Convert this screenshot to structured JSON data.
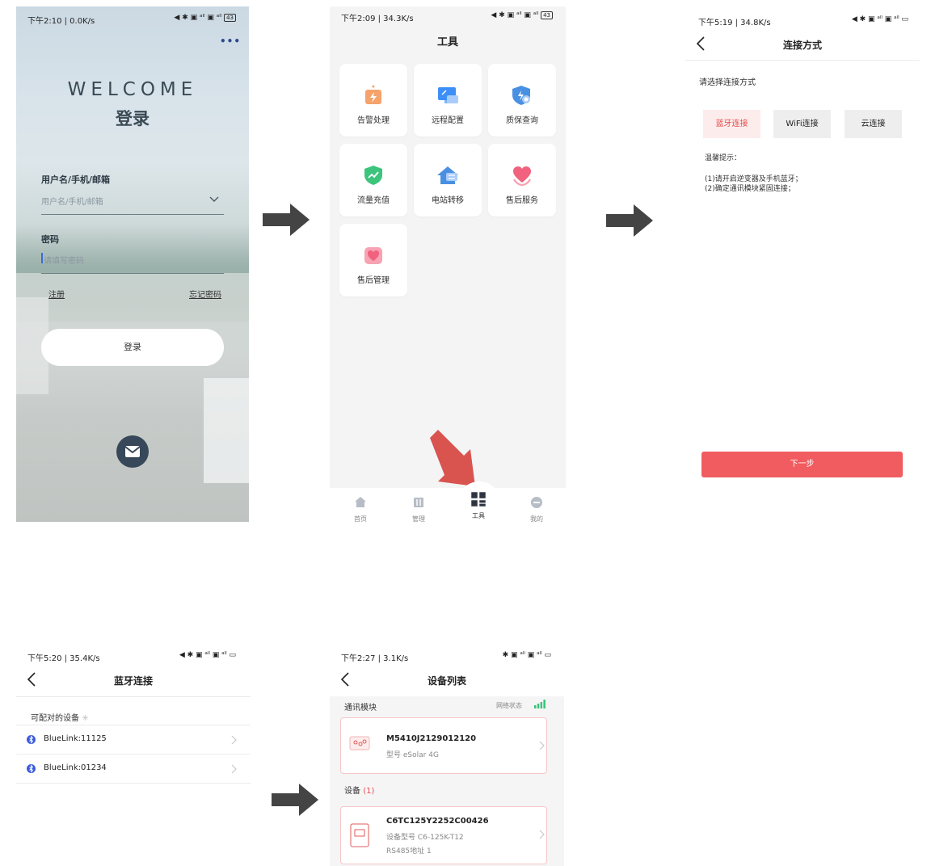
{
  "screen_login": {
    "status_left": "下午2:10 | 0.0K/s",
    "status_right": "43",
    "more": "•••",
    "welcome": "WELCOME",
    "title": "登录",
    "username_label": "用户名/手机/邮箱",
    "username_placeholder": "用户名/手机/邮箱",
    "password_label": "密码",
    "password_placeholder": "请填写密码",
    "register": "注册",
    "forgot": "忘记密码",
    "login_button": "登录"
  },
  "screen_tools": {
    "status_left": "下午2:09 | 34.3K/s",
    "status_right": "43",
    "title": "工具",
    "tools": [
      {
        "label": "告警处理",
        "icon": "alarm-icon",
        "color": "#f5a26b"
      },
      {
        "label": "远程配置",
        "icon": "remote-config-icon",
        "color": "#3e8ef7"
      },
      {
        "label": "质保查询",
        "icon": "warranty-icon",
        "color": "#4a90e2"
      },
      {
        "label": "流量充值",
        "icon": "data-topup-icon",
        "color": "#3cc47c"
      },
      {
        "label": "电站转移",
        "icon": "plant-transfer-icon",
        "color": "#4a90e2"
      },
      {
        "label": "售后服务",
        "icon": "after-sales-icon",
        "color": "#f0627e"
      },
      {
        "label": "售后管理",
        "icon": "after-sales-manage-icon",
        "color": "#f0627e"
      }
    ],
    "tabs": [
      {
        "label": "首页",
        "icon": "home-icon"
      },
      {
        "label": "管理",
        "icon": "manage-icon"
      },
      {
        "label": "工具",
        "icon": "tools-icon"
      },
      {
        "label": "我的",
        "icon": "profile-icon"
      }
    ],
    "highlight_color": "#d9534f"
  },
  "screen_connect": {
    "status_left": "下午5:19 | 34.8K/s",
    "title": "连接方式",
    "prompt": "请选择连接方式",
    "options": [
      "蓝牙连接",
      "WiFi连接",
      "云连接"
    ],
    "tips_title": "温馨提示：",
    "tips": [
      "(1)请开启逆变器及手机蓝牙；",
      "(2)确定通讯模块紧固连接；"
    ],
    "next_button": "下一步",
    "accent": "#f05c5f"
  },
  "screen_bluetooth": {
    "status_left": "下午5:20 | 35.4K/s",
    "title": "蓝牙连接",
    "section": "可配对的设备",
    "devices": [
      "BlueLink:11125",
      "BlueLink:01234"
    ]
  },
  "screen_devices": {
    "status_left": "下午2:27 | 3.1K/s",
    "title": "设备列表",
    "comm_section": "通讯模块",
    "network_status": "网络状态",
    "module": {
      "name": "M5410J2129012120",
      "model_label": "型号",
      "model": "eSolar 4G"
    },
    "device_section": "设备",
    "device_count": "(1)",
    "device": {
      "name": "C6TC125Y2252C00426",
      "model_label": "设备型号",
      "model": "C6-125K-T12",
      "rs485_label": "RS485地址",
      "rs485": "1"
    }
  }
}
